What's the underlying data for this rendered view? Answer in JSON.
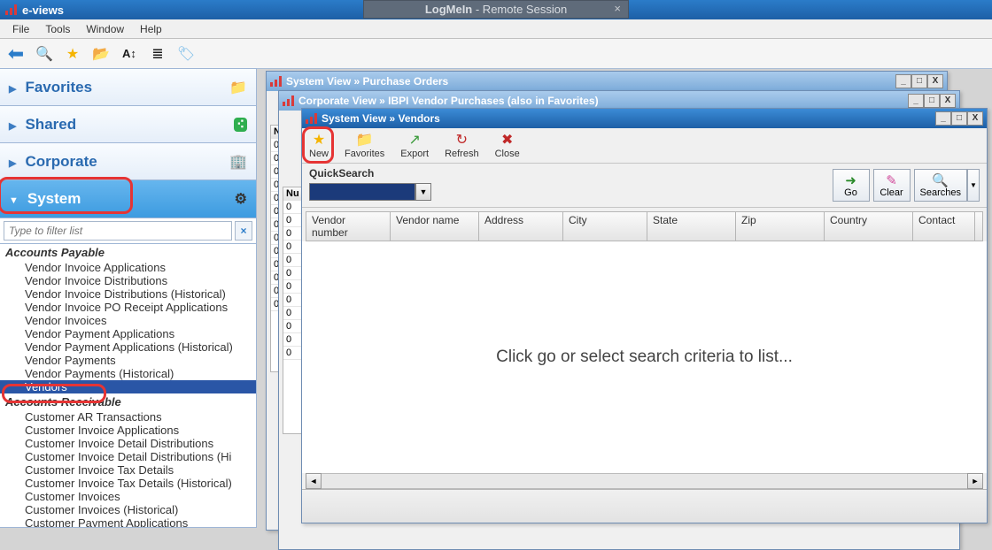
{
  "remote": {
    "label_a": "LogMeIn",
    "label_b": " -  Remote Session"
  },
  "app": {
    "title": "e-views"
  },
  "menu": {
    "file": "File",
    "tools": "Tools",
    "window": "Window",
    "help": "Help"
  },
  "sidebar": {
    "sections": {
      "favorites": "Favorites",
      "shared": "Shared",
      "corporate": "Corporate",
      "system": "System"
    },
    "filter_placeholder": "Type to filter list",
    "groups": {
      "ap": "Accounts Payable",
      "ar": "Accounts Receivable"
    },
    "ap_items": [
      "Vendor Invoice Applications",
      "Vendor Invoice Distributions",
      "Vendor Invoice Distributions (Historical)",
      "Vendor Invoice PO Receipt Applications",
      "Vendor Invoices",
      "Vendor Payment Applications",
      "Vendor Payment Applications (Historical)",
      "Vendor Payments",
      "Vendor Payments (Historical)",
      "Vendors"
    ],
    "ar_items": [
      "Customer AR Transactions",
      "Customer Invoice Applications",
      "Customer Invoice Detail Distributions",
      "Customer Invoice Detail Distributions (Hi",
      "Customer Invoice Tax Details",
      "Customer Invoice Tax Details (Historical)",
      "Customer Invoices",
      "Customer Invoices (Historical)",
      "Customer Payment Applications"
    ]
  },
  "windows": {
    "w1": {
      "title_a": "System View",
      "sep": " » ",
      "title_b": "Purchase Orders"
    },
    "w2": {
      "title_a": "Corporate View",
      "sep": " » ",
      "title_b": "IBPI Vendor Purchases  (also in Favorites)"
    },
    "w3": {
      "title_a": "System View",
      "sep": " » ",
      "title_b": "Vendors",
      "toolbar": {
        "new": "New",
        "favorites": "Favorites",
        "export": "Export",
        "refresh": "Refresh",
        "close": "Close"
      },
      "qs_label": "QuickSearch",
      "buttons": {
        "go": "Go",
        "clear": "Clear",
        "searches": "Searches"
      },
      "columns": [
        "Vendor number",
        "Vendor name",
        "Address",
        "City",
        "State",
        "Zip",
        "Country",
        "Contact"
      ],
      "empty": "Click go or select search criteria to list..."
    },
    "ctrl": {
      "min": "_",
      "max": "□",
      "close": "X"
    },
    "slim_hd": "Nu"
  }
}
